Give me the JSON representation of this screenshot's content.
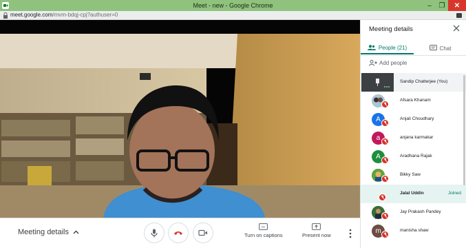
{
  "window": {
    "title": "Meet - new - Google Chrome"
  },
  "browser": {
    "url_host": "meet.google.com",
    "url_path": "/mvm-bdqj-cpj?authuser=0"
  },
  "meeting": {
    "details_label": "Meeting details",
    "captions_label": "Turn on captions",
    "present_label": "Present now"
  },
  "panel": {
    "title": "Meeting details",
    "tab_people": "People (21)",
    "tab_chat": "Chat",
    "add_people": "Add people",
    "participants": [
      {
        "name": "Sandip Chatterjee (You)"
      },
      {
        "name": "Afsara Khanam"
      },
      {
        "name": "Anjali Choudhary",
        "initial": "A"
      },
      {
        "name": "anjana karmakar",
        "initial": "a"
      },
      {
        "name": "Aradhana Rajak",
        "initial": "A"
      },
      {
        "name": "Bikky Saw"
      },
      {
        "name": "Jalal Uddin",
        "status": "Joined"
      },
      {
        "name": "Jay Prakash Pandey"
      },
      {
        "name": "manisha shaw",
        "initial": "m"
      }
    ]
  },
  "colors": {
    "accent": "#00796b",
    "title_bar": "#8fc27d",
    "mute_red": "#d93025",
    "avatar_blue": "#1a73e8",
    "avatar_pink": "#c2185b",
    "avatar_green": "#1e8e3e",
    "avatar_brown": "#6d4c41"
  }
}
